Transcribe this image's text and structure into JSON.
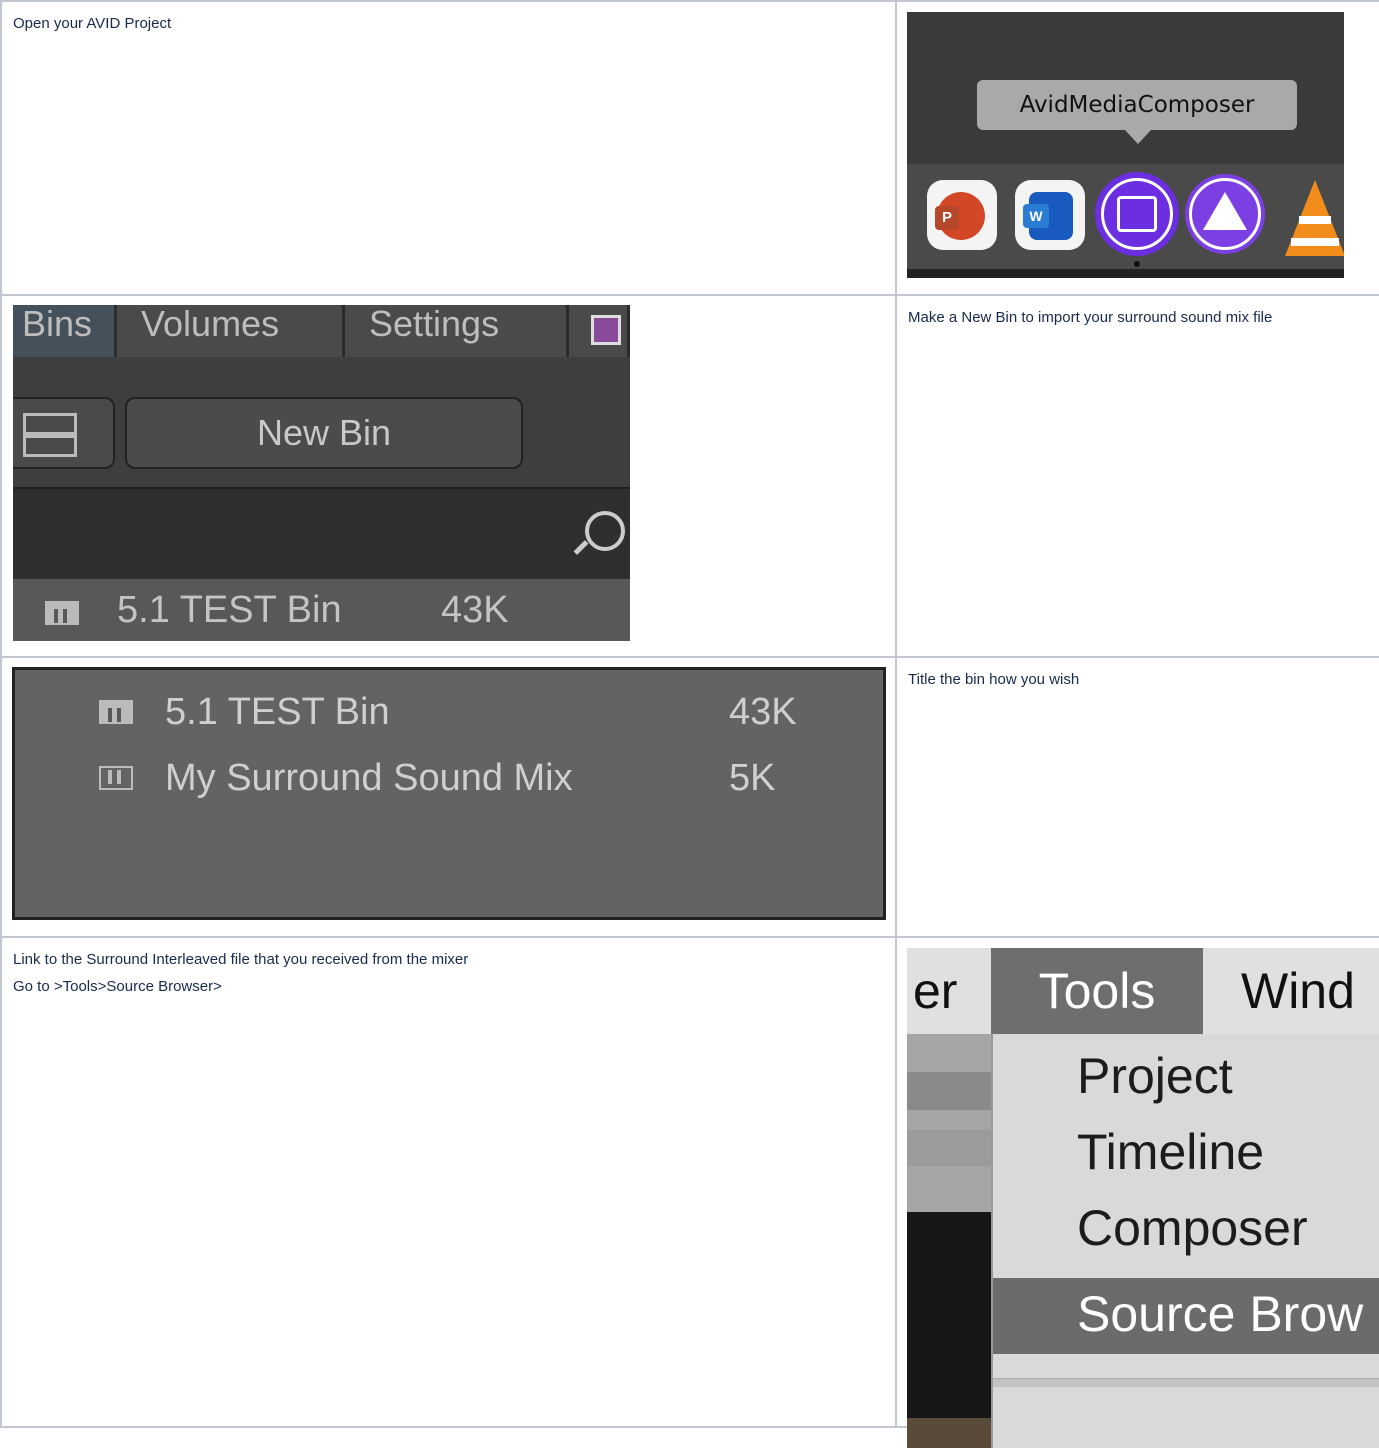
{
  "steps": [
    {
      "text": "Open your AVID Project"
    },
    {
      "text": "Make a New Bin to import your surround sound mix file"
    },
    {
      "text": "Title the bin how you wish"
    },
    {
      "text": "Link to the Surround Interleaved file that you received from the mixer",
      "text2": "Go to >Tools>Source Browser>"
    }
  ],
  "dock": {
    "tooltip": "AvidMediaComposer",
    "apps": [
      {
        "icon": "powerpoint-icon",
        "letter": "P"
      },
      {
        "icon": "word-icon",
        "letter": "W"
      },
      {
        "icon": "avid-media-composer-icon"
      },
      {
        "icon": "pro-tools-icon"
      },
      {
        "icon": "vlc-icon"
      }
    ]
  },
  "avid_project": {
    "tabs": [
      "Bins",
      "Volumes",
      "Settings"
    ],
    "new_bin_label": "New Bin",
    "bin_name": "5.1 TEST Bin",
    "bin_size": "43K"
  },
  "bin_list": [
    {
      "name": "5.1 TEST Bin",
      "size": "43K"
    },
    {
      "name": "My Surround Sound Mix",
      "size": "5K"
    }
  ],
  "tools_menu": {
    "menubar": [
      "er",
      "Tools",
      "Wind"
    ],
    "items": [
      "Project",
      "Timeline",
      "Composer",
      "Source Brow"
    ],
    "highlighted_item": "Source Brow"
  }
}
